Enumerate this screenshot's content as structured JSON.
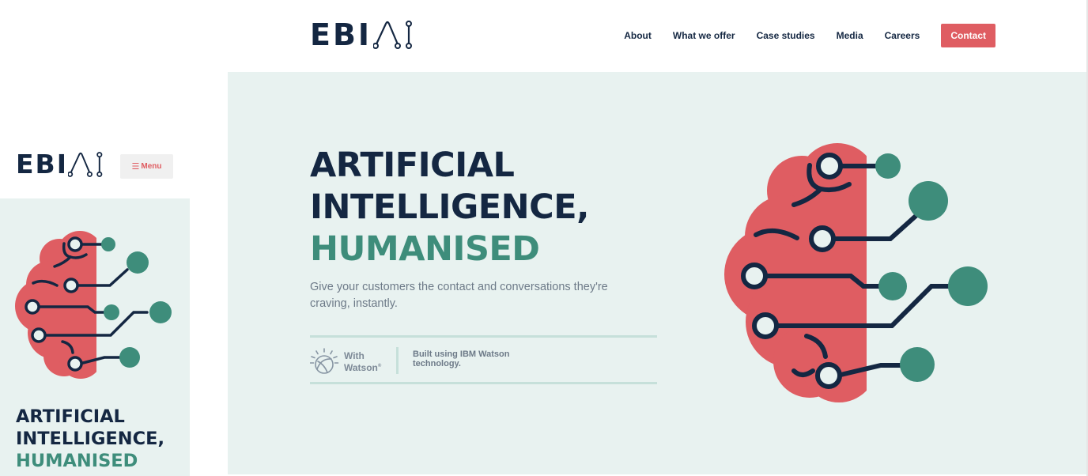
{
  "brand": {
    "name": "EBI",
    "logo_icon": "ai-circuit-logo-icon"
  },
  "nav": {
    "items": [
      {
        "label": "About"
      },
      {
        "label": "What we offer"
      },
      {
        "label": "Case studies"
      },
      {
        "label": "Media"
      },
      {
        "label": "Careers"
      }
    ],
    "contact_label": "Contact"
  },
  "hero": {
    "title_line1": "ARTIFICIAL",
    "title_line2": "INTELLIGENCE,",
    "title_line3": "HUMANISED",
    "subtitle": "Give your customers the contact and conversations they're craving, instantly.",
    "watson": {
      "badge_line1": "With",
      "badge_line2": "Watson",
      "badge_mark": "®",
      "text": "Built using IBM Watson technology."
    }
  },
  "mobile": {
    "menu_label": "Menu",
    "menu_icon": "hamburger-icon"
  },
  "colors": {
    "navy": "#142742",
    "coral": "#df5d62",
    "teal": "#3e8d7b",
    "hero_bg": "#e8f2f0",
    "muted_text": "#6d7a88"
  }
}
